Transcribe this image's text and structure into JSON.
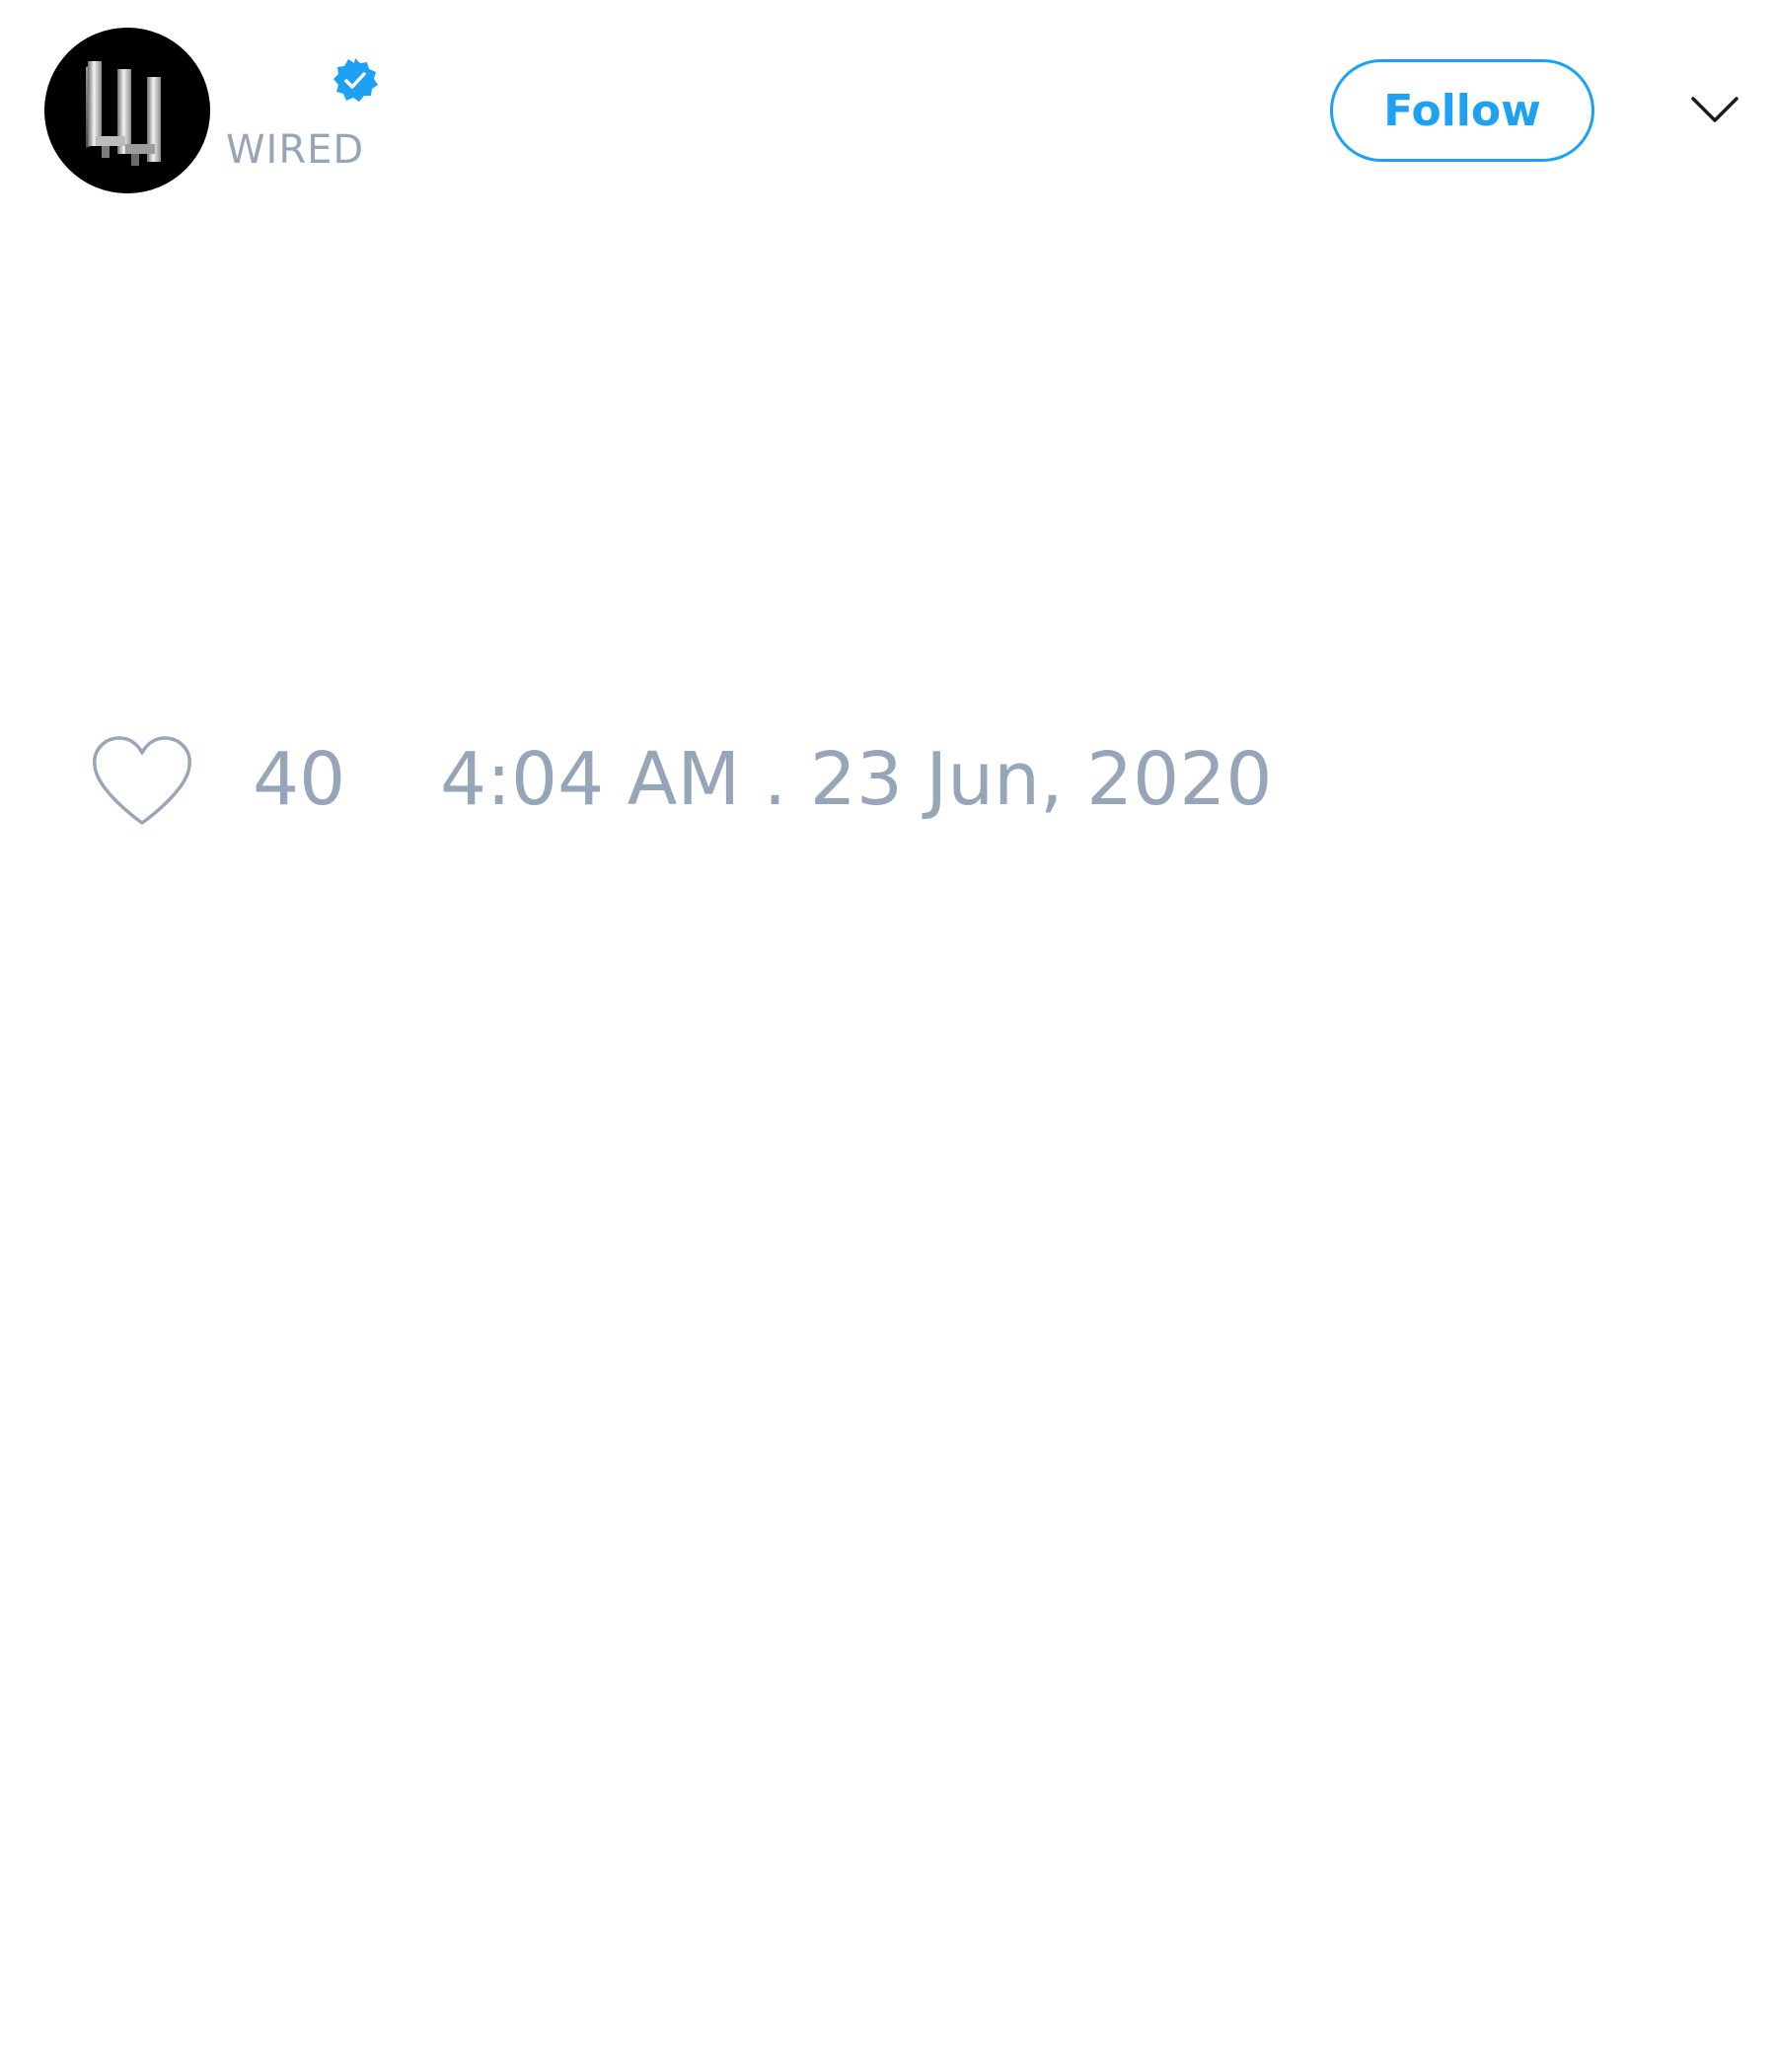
{
  "tweet": {
    "author": {
      "handle": "WIRED",
      "verified": true,
      "avatar_icon": "wired-logo-icon",
      "avatar_background": "#000000"
    },
    "follow_label": "Follow",
    "more_icon": "chevron-down-icon",
    "like_icon": "heart-outline-icon",
    "like_count": "40",
    "timestamp": "4:04 AM . 23 Jun, 2020"
  },
  "colors": {
    "accent": "#1da1f2",
    "muted_text": "#97a5b8",
    "background": "#ffffff",
    "icon_gray": "#98a6b8",
    "chevron": "#1a1a1a"
  }
}
